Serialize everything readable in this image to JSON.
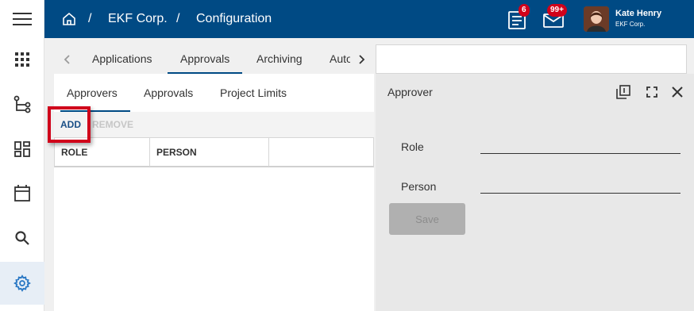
{
  "header": {
    "breadcrumb": [
      "EKF Corp.",
      "Configuration"
    ],
    "separator": "/",
    "tasks_badge": "6",
    "mail_badge": "99+",
    "user_name": "Kate Henry",
    "user_org": "EKF Corp."
  },
  "top_tabs": [
    "Applications",
    "Approvals",
    "Archiving",
    "Automation"
  ],
  "top_tabs_active": "Approvals",
  "sub_tabs": [
    "Approvers",
    "Approvals",
    "Project Limits"
  ],
  "sub_tabs_active": "Approvers",
  "toolbar": {
    "add": "ADD",
    "remove": "REMOVE"
  },
  "grid": {
    "columns": [
      "ROLE",
      "PERSON",
      ""
    ]
  },
  "detail": {
    "title": "Approver",
    "fields": [
      {
        "label": "Role",
        "value": ""
      },
      {
        "label": "Person",
        "value": ""
      }
    ],
    "save": "Save"
  },
  "colors": {
    "header": "#004a84",
    "badge": "#d0021b",
    "highlight": "#d0021b"
  }
}
